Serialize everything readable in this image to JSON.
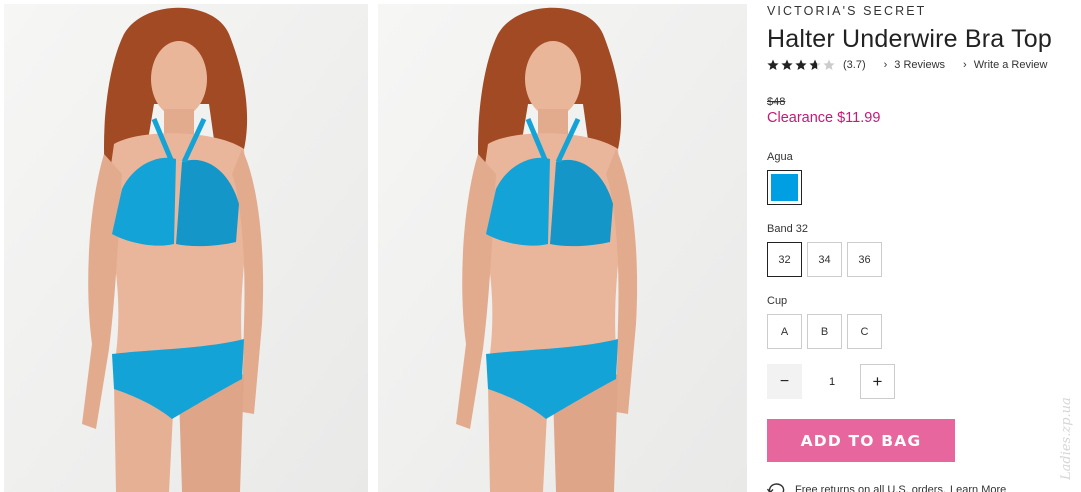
{
  "product": {
    "brand": "VICTORIA'S SECRET",
    "title": "Halter Underwire Bra Top",
    "rating_value": 3.7,
    "rating_text": "(3.7)",
    "reviews_link": "3 Reviews",
    "write_review_link": "Write a Review",
    "original_price": "$48",
    "sale_price": "Clearance $11.99"
  },
  "color": {
    "label": "Agua",
    "swatch_hex": "#009ee3"
  },
  "band": {
    "label": "Band 32",
    "options": [
      "32",
      "34",
      "36"
    ],
    "selected": "32"
  },
  "cup": {
    "label": "Cup",
    "options": [
      "A",
      "B",
      "C"
    ]
  },
  "quantity": {
    "minus": "−",
    "value": "1",
    "plus": "+"
  },
  "cta": {
    "add_to_bag": "ADD TO BAG"
  },
  "returns": {
    "text": "Free returns on all U.S. orders.",
    "learn_more": "Learn More"
  },
  "colors": {
    "accent_pink": "#e8669e",
    "clearance_pink": "#c61878",
    "bikini_blue": "#14a3d6"
  },
  "watermark": "Ladies.zp.ua"
}
